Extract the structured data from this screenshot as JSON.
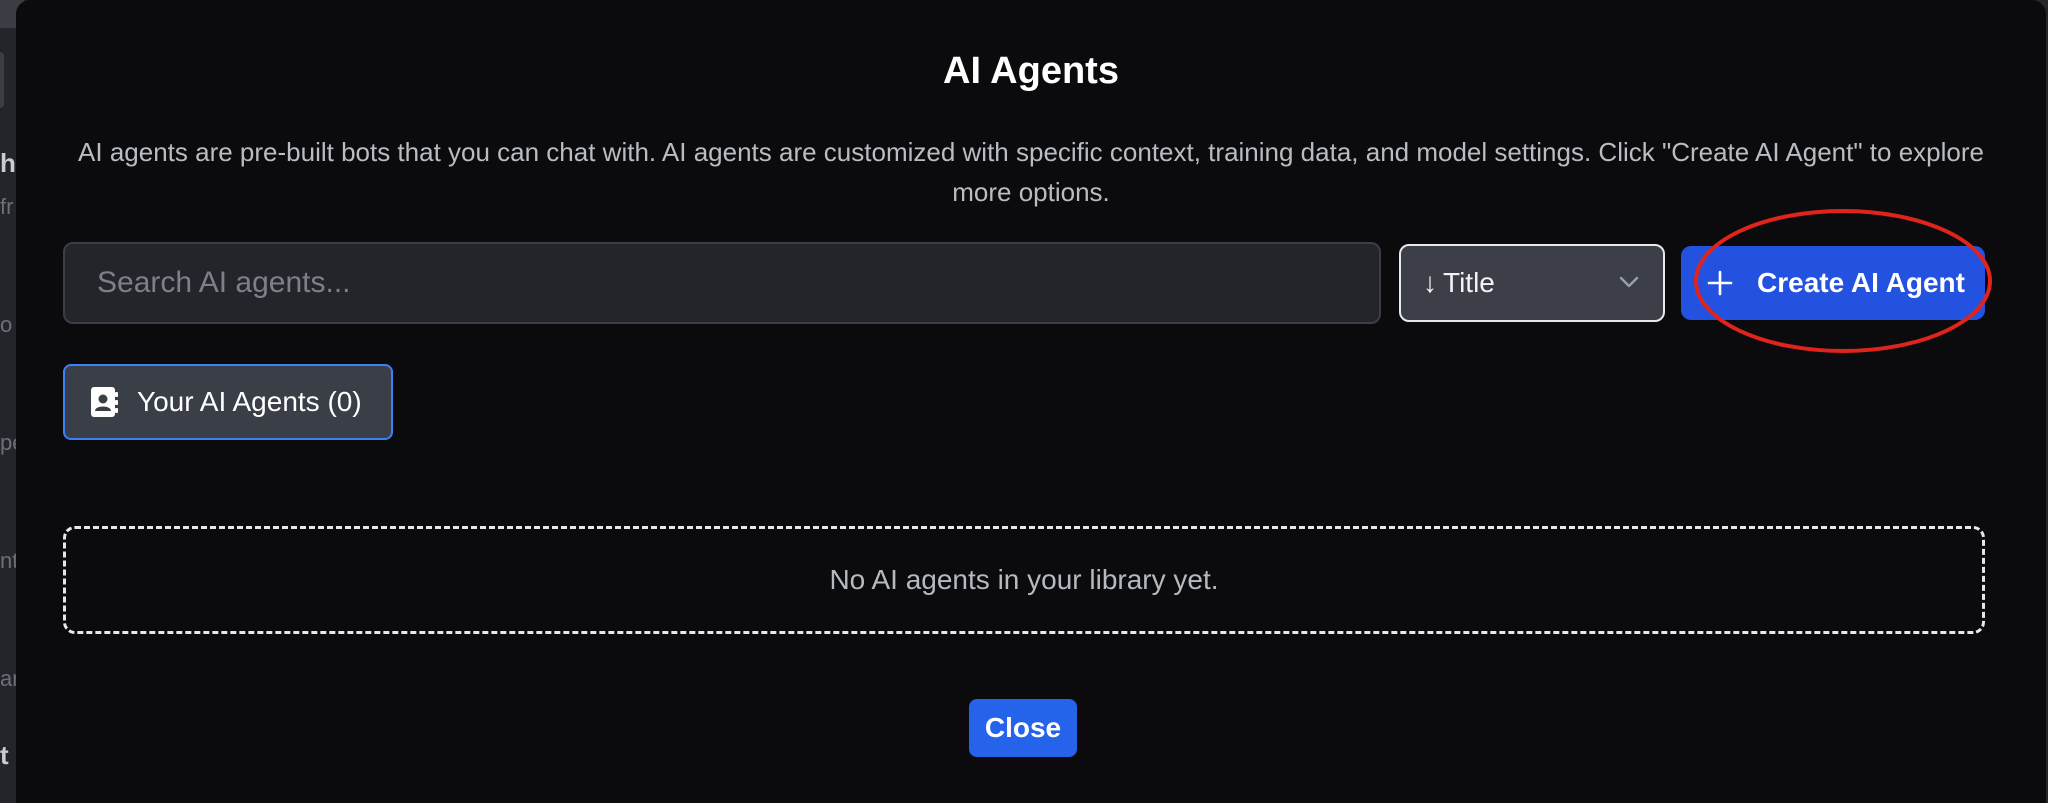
{
  "modal": {
    "title": "AI Agents",
    "description": "AI agents are pre-built bots that you can chat with. AI agents are customized with specific context, training data, and model settings. Click \"Create AI Agent\" to explore more options.",
    "search": {
      "placeholder": "Search AI agents...",
      "value": ""
    },
    "sort": {
      "arrow": "↓",
      "label": "Title",
      "icon": "chevron-down-icon"
    },
    "create_button": {
      "label": "Create AI Agent",
      "icon": "plus-icon"
    },
    "tab": {
      "label": "Your AI Agents (0)",
      "icon": "contact-book-icon"
    },
    "empty_message": "No AI agents in your library yet.",
    "close_label": "Close"
  },
  "background": {
    "fragments": [
      "h",
      "fr",
      "o",
      "pe",
      "nt",
      "an",
      "t"
    ]
  },
  "colors": {
    "modal_bg": "#0b0b0e",
    "accent_blue": "#2352e0",
    "annotation_red": "#e0241b",
    "tab_border": "#3b82f6"
  }
}
